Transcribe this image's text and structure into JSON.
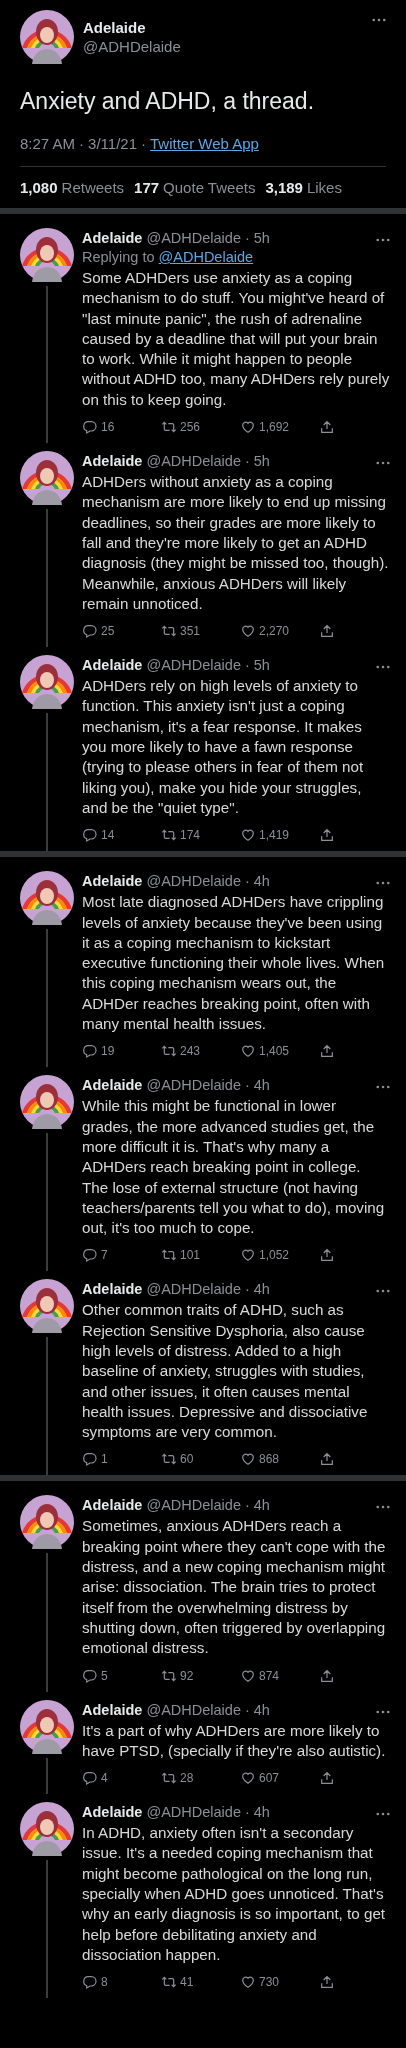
{
  "main_tweet": {
    "name": "Adelaide",
    "handle": "@ADHDelaide",
    "text": "Anxiety and ADHD, a thread.",
    "time": "8:27 AM",
    "sep_1": "·",
    "date": "3/11/21",
    "sep_2": "·",
    "source": "Twitter Web App",
    "stats": [
      {
        "count": "1,080",
        "label": "Retweets"
      },
      {
        "count": "177",
        "label": "Quote Tweets"
      },
      {
        "count": "3,189",
        "label": "Likes"
      }
    ]
  },
  "segments": [
    {
      "tweets": [
        {
          "name": "Adelaide",
          "handle": "@ADHDelaide",
          "time": "5h",
          "replying_to": {
            "prefix": "Replying to",
            "handle": "@ADHDelaide"
          },
          "text": "Some ADHDers use anxiety as a coping mechanism to do stuff. You might've heard of \"last minute panic\", the rush of adrenaline caused by a deadline that will put your brain to work. While it might happen to people without ADHD too, many ADHDers rely purely on this to keep going.",
          "replies": "16",
          "retweets": "256",
          "likes": "1,692"
        },
        {
          "name": "Adelaide",
          "handle": "@ADHDelaide",
          "time": "5h",
          "text": "ADHDers without anxiety as a coping mechanism are more likely to end up missing deadlines, so their grades are more likely to fall and they're more likely to get an ADHD diagnosis (they might be missed too, though). Meanwhile, anxious ADHDers will likely remain unnoticed.",
          "replies": "25",
          "retweets": "351",
          "likes": "2,270"
        },
        {
          "name": "Adelaide",
          "handle": "@ADHDelaide",
          "time": "5h",
          "text": "ADHDers rely on high levels of anxiety to function. This anxiety isn't just a coping mechanism, it's a fear response. It makes you more likely to have a fawn response (trying to please others in fear of them not liking you), make you hide your struggles, and be the \"quiet type\".",
          "replies": "14",
          "retweets": "174",
          "likes": "1,419"
        }
      ]
    },
    {
      "tweets": [
        {
          "name": "Adelaide",
          "handle": "@ADHDelaide",
          "time": "4h",
          "text": "Most late diagnosed ADHDers have crippling levels of anxiety because they've been using it as a coping mechanism to kickstart executive functioning their whole lives. When this coping mechanism wears out, the ADHDer reaches breaking point, often with many mental health issues.",
          "replies": "19",
          "retweets": "243",
          "likes": "1,405"
        },
        {
          "name": "Adelaide",
          "handle": "@ADHDelaide",
          "time": "4h",
          "text": "While this might be functional in lower grades, the more advanced studies get, the more difficult it is. That's why many a ADHDers reach breaking point in college. The lose of external structure (not having teachers/parents tell you what to do), moving out, it's too much to cope.",
          "replies": "7",
          "retweets": "101",
          "likes": "1,052"
        },
        {
          "name": "Adelaide",
          "handle": "@ADHDelaide",
          "time": "4h",
          "text": "Other common traits of ADHD, such as Rejection Sensitive Dysphoria, also cause high levels of distress. Added to a high baseline of anxiety, struggles with studies, and other issues, it often causes mental health issues. Depressive and dissociative symptoms are very common.",
          "replies": "1",
          "retweets": "60",
          "likes": "868"
        }
      ]
    },
    {
      "tweets": [
        {
          "name": "Adelaide",
          "handle": "@ADHDelaide",
          "time": "4h",
          "text": "Sometimes, anxious ADHDers reach a breaking point where they can't cope with the distress, and a new coping mechanism might arise: dissociation. The brain tries to protect itself from the overwhelming distress by shutting down, often triggered by overlapping emotional distress.",
          "replies": "5",
          "retweets": "92",
          "likes": "874"
        },
        {
          "name": "Adelaide",
          "handle": "@ADHDelaide",
          "time": "4h",
          "text": "It's a part of why ADHDers are more likely to have PTSD, (specially if they're also autistic).",
          "replies": "4",
          "retweets": "28",
          "likes": "607"
        },
        {
          "name": "Adelaide",
          "handle": "@ADHDelaide",
          "time": "4h",
          "text": "In ADHD, anxiety often isn't a secondary issue. It's a needed coping mechanism that might become pathological on the long run, specially when ADHD goes unnoticed. That's why an early diagnosis is so important, to get help before debilitating anxiety and dissociation happen.",
          "replies": "8",
          "retweets": "41",
          "likes": "730"
        }
      ]
    }
  ]
}
